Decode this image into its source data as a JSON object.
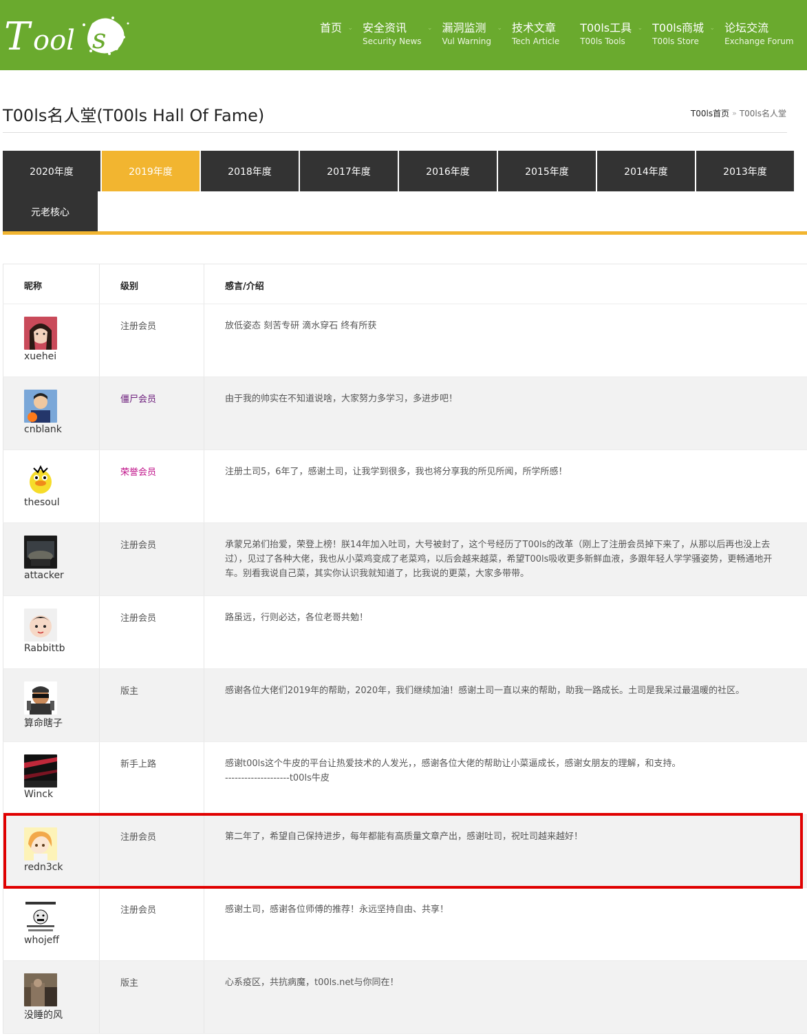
{
  "logo_text": "Tools",
  "nav": [
    {
      "cn": "首页",
      "en": ""
    },
    {
      "cn": "安全资讯",
      "en": "Security News"
    },
    {
      "cn": "漏洞监测",
      "en": "Vul Warning"
    },
    {
      "cn": "技术文章",
      "en": "Tech Article"
    },
    {
      "cn": "T00ls工具",
      "en": "T00ls Tools"
    },
    {
      "cn": "T00ls商城",
      "en": "T00ls Store"
    },
    {
      "cn": "论坛交流",
      "en": "Exchange Forum"
    }
  ],
  "page": {
    "title": "T00ls名人堂(T00ls Hall Of Fame)",
    "breadcrumb_home": "T00ls首页",
    "breadcrumb_sep": "»",
    "breadcrumb_current": "T00ls名人堂"
  },
  "tabs": [
    "2020年度",
    "2019年度",
    "2018年度",
    "2017年度",
    "2016年度",
    "2015年度",
    "2014年度",
    "2013年度",
    "元老核心"
  ],
  "active_tab": "2019年度",
  "table": {
    "headers": [
      "昵称",
      "级别",
      "感言/介绍"
    ],
    "rows": [
      {
        "nick": "xuehei",
        "level": "注册会员",
        "level_color": "#555555",
        "intro": "放低姿态 刻苦专研 滴水穿石 终有所获"
      },
      {
        "nick": "cnblank",
        "level": "僵尸会员",
        "level_color": "#6a1a7a",
        "intro": "由于我的帅实在不知道说啥，大家努力多学习，多进步吧！"
      },
      {
        "nick": "thesoul",
        "level": "荣誉会员",
        "level_color": "#c0138a",
        "intro": "注册土司5，6年了，感谢土司，让我学到很多，我也将分享我的所见所闻，所学所感！"
      },
      {
        "nick": "attacker",
        "level": "注册会员",
        "level_color": "#555555",
        "intro": "承蒙兄弟们抬爱，荣登上榜！朕14年加入吐司，大号被封了，这个号经历了T00ls的改革（刚上了注册会员掉下来了，从那以后再也没上去过），见过了各种大佬，我也从小菜鸡变成了老菜鸡，以后会越来越菜，希望T00ls吸收更多新鲜血液，多跟年轻人学学骚姿势，更畅通地开车。别看我说自己菜，其实你认识我就知道了，比我说的更菜，大家多带带。"
      },
      {
        "nick": "Rabbittb",
        "level": "注册会员",
        "level_color": "#555555",
        "intro": "路虽远，行则必达，各位老哥共勉！"
      },
      {
        "nick": "算命瞎子",
        "level": "版主",
        "level_color": "#555555",
        "intro": "感谢各位大佬们2019年的帮助，2020年，我们继续加油！感谢土司一直以来的帮助，助我一路成长。土司是我呆过最温暖的社区。"
      },
      {
        "nick": "Winck",
        "level": "新手上路",
        "level_color": "#555555",
        "intro": "感谢t00ls这个牛皮的平台让热爱技术的人发光，，感谢各位大佬的帮助让小菜逼成长，感谢女朋友的理解，和支持。\n--------------------t00ls牛皮"
      },
      {
        "nick": "redn3ck",
        "level": "注册会员",
        "level_color": "#555555",
        "intro": "第二年了，希望自己保持进步，每年都能有高质量文章产出，感谢吐司，祝吐司越来越好！"
      },
      {
        "nick": "whojeff",
        "level": "注册会员",
        "level_color": "#555555",
        "intro": "感谢土司，感谢各位师傅的推荐！永远坚持自由、共享！"
      },
      {
        "nick": "没睡的风",
        "level": "版主",
        "level_color": "#555555",
        "intro": "心系疫区，共抗病魔，t00ls.net与你同在！"
      }
    ]
  },
  "colors": {
    "header_green": "#6aaa2e",
    "tab_dark": "#333333",
    "tab_active": "#f2b530",
    "highlight_red": "#e00000"
  }
}
